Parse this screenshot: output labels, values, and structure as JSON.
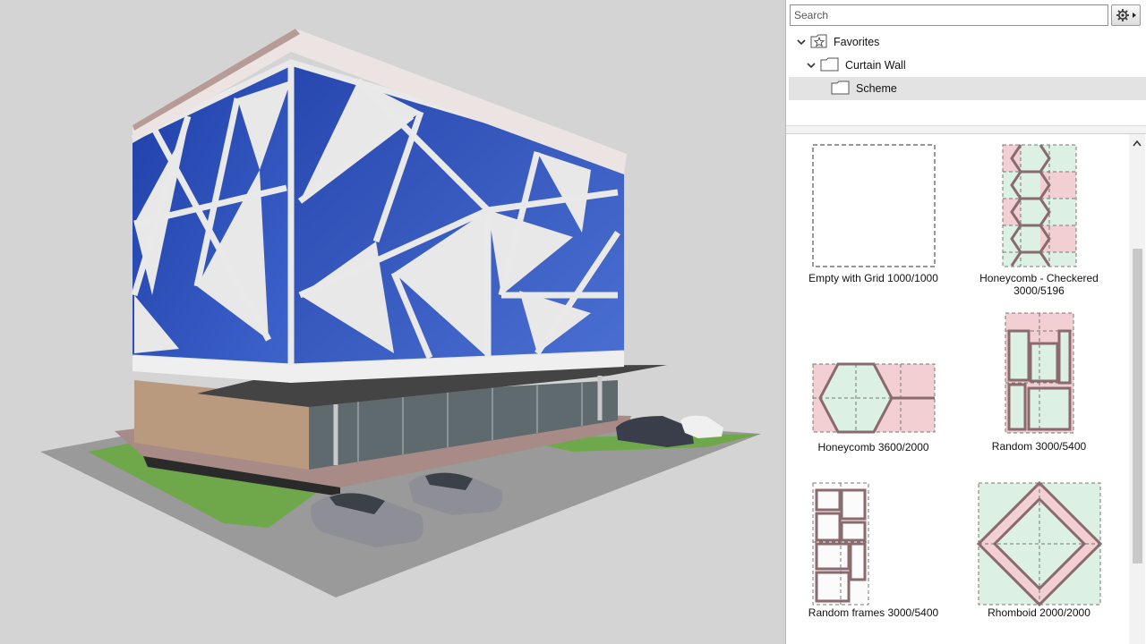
{
  "search": {
    "placeholder": "Search"
  },
  "toolbar": {
    "settings_icon": "gear-icon"
  },
  "tree": {
    "favorites": "Favorites",
    "curtain_wall": "Curtain Wall",
    "scheme": "Scheme"
  },
  "schemes": [
    {
      "label": "Empty with Grid 1000/1000"
    },
    {
      "label": "Honeycomb - Checkered",
      "label2": "3000/5196"
    },
    {
      "label": "Honeycomb 3600/2000"
    },
    {
      "label": "Random 3000/5400"
    },
    {
      "label": "Random frames 3000/5400"
    },
    {
      "label": "Rhomboid 2000/2000"
    }
  ],
  "colors": {
    "glass": "#2d4fb0",
    "panel_bg": "#ffffff",
    "selection": "#e3e3e3",
    "scheme_fill": "#f2cfd2",
    "scheme_fill2": "#dcf0e4"
  }
}
